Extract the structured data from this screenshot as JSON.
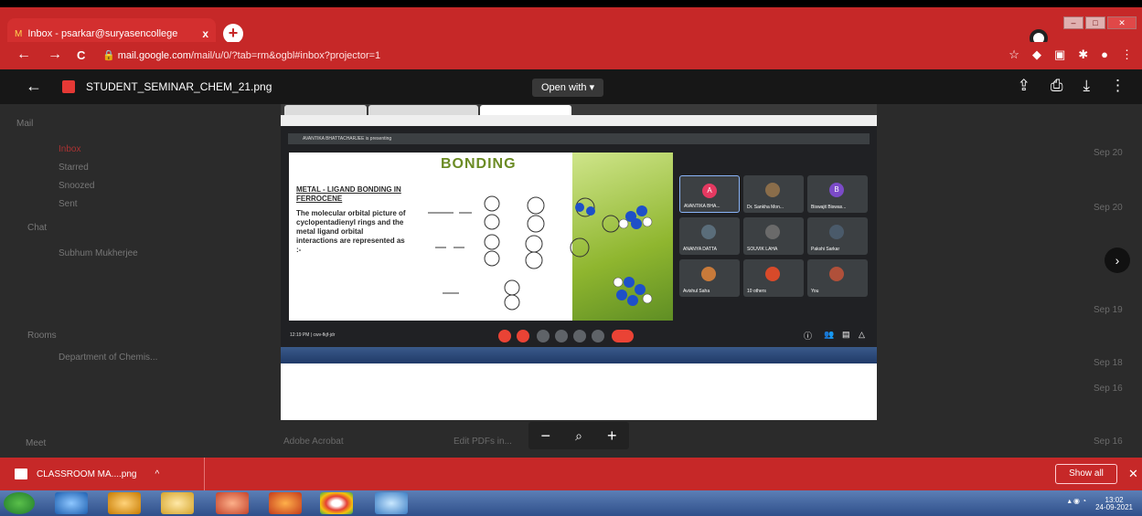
{
  "browser": {
    "tab_title": "Inbox - psarkar@suryasencollege",
    "tab_close": "x",
    "new_tab": "+",
    "url_domain": "mail.google.com",
    "url_rest": "/mail/u/0/?tab=rm&ogbl#inbox?projector=1",
    "nav": {
      "back": "←",
      "forward": "→",
      "reload": "C"
    }
  },
  "viewer": {
    "back": "←",
    "file_name": "STUDENT_SEMINAR_CHEM_21.png",
    "open_with": "Open with ▾",
    "zoom_out": "−",
    "zoom_icon": "🔍",
    "zoom_in": "+",
    "next": "›"
  },
  "gmail": {
    "sidebar": [
      "Mail",
      "Inbox",
      "Starred",
      "Snoozed",
      "Sent",
      "Chat",
      "Subhum Mukherjee",
      "Rooms",
      "Department of Chemis...",
      "Meet"
    ],
    "rows": [
      "Sep 20",
      "Sep 20",
      "Sep 19",
      "Sep 18",
      "Sep 16",
      "Sep 16"
    ],
    "promo_sender": "Adobe Acrobat",
    "promo_text": "Edit PDFs in..."
  },
  "meet_screen": {
    "banner": "AVANTIKA BHATTACHARJEE is presenting",
    "slide_title": "BONDING",
    "slide_heading": "METAL - LIGAND BONDING IN FERROCENE",
    "slide_body": "The molecular orbital picture of cyclopentadienyl rings and the metal ligand orbital interactions are represented as :-",
    "participants": [
      {
        "name": "AVANTIKA BHA...",
        "initial": "A",
        "color": "#e53961"
      },
      {
        "name": "Dr. Sankha Mon...",
        "initial": "",
        "color": "#8a6d4a"
      },
      {
        "name": "Biswajit Biswas...",
        "initial": "B",
        "color": "#7b4bc8"
      },
      {
        "name": "ANANYA DATTA",
        "initial": "",
        "color": "#5a6d7a"
      },
      {
        "name": "SOUVIK LAHA",
        "initial": "",
        "color": "#6a6a6a"
      },
      {
        "name": "Pakshi Sarkar",
        "initial": "",
        "color": "#4a5a6a"
      },
      {
        "name": "Avishul Saha",
        "initial": "",
        "color": "#c87a3a"
      },
      {
        "name": "10 others",
        "initial": "",
        "color": "#d84a2a"
      },
      {
        "name": "You",
        "initial": "",
        "color": "#b0503a"
      }
    ],
    "time": "12:19 PM | cwv-fkjf-jdr"
  },
  "download": {
    "file": "CLASSROOM MA....png",
    "chevron": "^",
    "show_all": "Show all",
    "close": "✕"
  },
  "taskbar": {
    "time": "13:02",
    "date": "24-09-2021"
  }
}
